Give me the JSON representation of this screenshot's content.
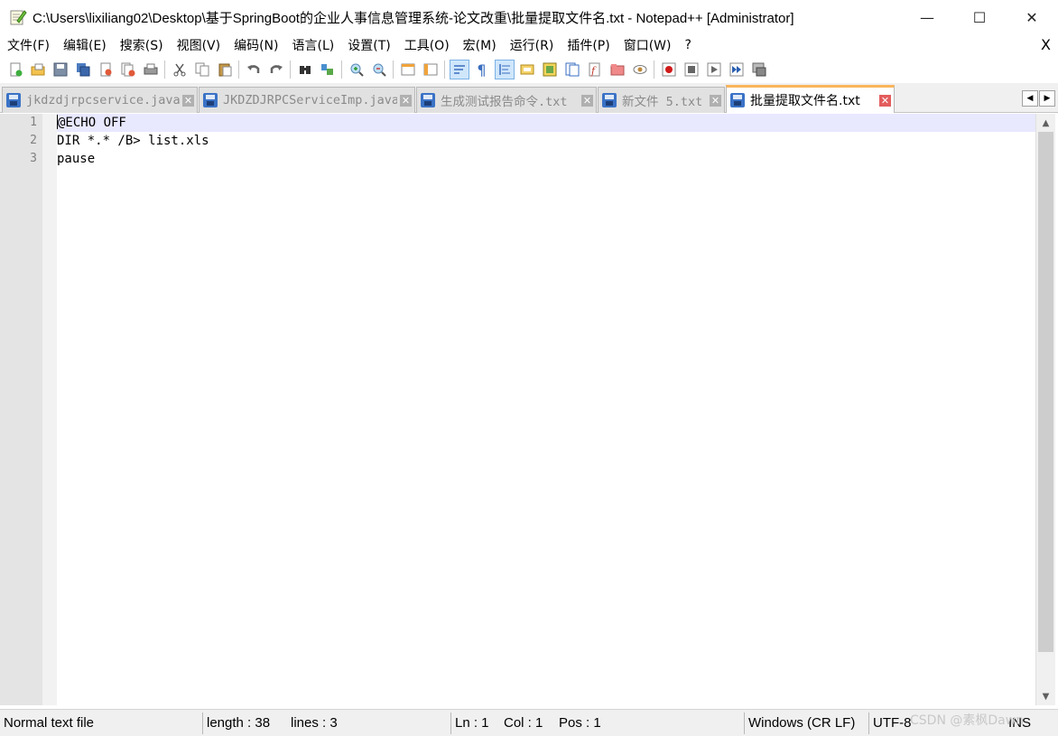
{
  "window": {
    "title": "C:\\Users\\lixiliang02\\Desktop\\基于SpringBoot的企业人事信息管理系统-论文改重\\批量提取文件名.txt - Notepad++ [Administrator]",
    "minimize": "—",
    "maximize": "☐",
    "close": "✕"
  },
  "menu": {
    "items": [
      "文件(F)",
      "编辑(E)",
      "搜索(S)",
      "视图(V)",
      "编码(N)",
      "语言(L)",
      "设置(T)",
      "工具(O)",
      "宏(M)",
      "运行(R)",
      "插件(P)",
      "窗口(W)",
      "?"
    ],
    "close_doc": "X"
  },
  "toolbar": {
    "icons": [
      "new-file-icon",
      "open-file-icon",
      "save-icon",
      "save-all-icon",
      "close-icon",
      "close-all-icon",
      "print-icon",
      "cut-icon",
      "copy-icon",
      "paste-icon",
      "undo-icon",
      "redo-icon",
      "find-icon",
      "replace-icon",
      "zoom-in-icon",
      "zoom-out-icon",
      "sync-vertical-icon",
      "sync-horizontal-icon",
      "word-wrap-icon",
      "show-all-chars-icon",
      "indent-guide-icon",
      "user-defined-lang-icon",
      "doc-map-icon",
      "function-list-icon",
      "folder-as-workspace-icon",
      "monitoring-icon",
      "record-macro-icon",
      "stop-record-icon",
      "play-macro-icon",
      "run-macro-multiple-icon",
      "save-macro-icon"
    ]
  },
  "tabs": [
    {
      "label": "jkdzdjrpcservice.java",
      "active": false
    },
    {
      "label": "JKDZDJRPCServiceImp.java",
      "active": false
    },
    {
      "label": "生成测试报告命令.txt",
      "active": false
    },
    {
      "label": "新文件 5.txt",
      "active": false
    },
    {
      "label": "批量提取文件名.txt",
      "active": true
    }
  ],
  "tab_scroll": {
    "left": "◀",
    "right": "▶"
  },
  "editor": {
    "line_numbers": [
      "1",
      "2",
      "3"
    ],
    "lines": [
      "@ECHO OFF",
      "DIR *.* /B> list.xls",
      "pause"
    ],
    "current_line": 1
  },
  "scrollbar": {
    "up": "▲",
    "down": "▼"
  },
  "status": {
    "file_type": "Normal text file",
    "length": "length : 38",
    "lines": "lines : 3",
    "ln": "Ln : 1",
    "col": "Col : 1",
    "pos": "Pos : 1",
    "eol": "Windows (CR LF)",
    "encoding": "UTF-8",
    "mode": "INS"
  },
  "watermark": "CSDN @素枫Dawn",
  "colors": {
    "current_line": "#e8e8ff",
    "active_tab_accent": "#fab55b",
    "tab_close_active": "#e35d5d",
    "save_icon_blue": "#3a72c6"
  }
}
